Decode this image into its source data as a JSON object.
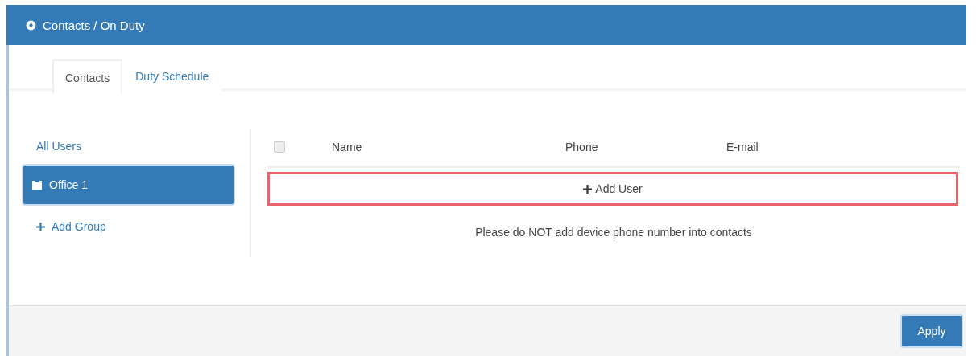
{
  "header": {
    "title": "Contacts / On Duty"
  },
  "tabs": [
    {
      "label": "Contacts",
      "selected": true
    },
    {
      "label": "Duty Schedule",
      "selected": false
    }
  ],
  "groups": [
    {
      "label": "All Users",
      "selected": false,
      "kind": "all"
    },
    {
      "label": "Office 1",
      "selected": true,
      "kind": "group"
    }
  ],
  "add_group": "Add Group",
  "table": {
    "select_all": {
      "checked": false
    },
    "columns": [
      "Name",
      "Phone",
      "E-mail"
    ]
  },
  "add_user": {
    "label": "Add User",
    "highlighted": true
  },
  "notice": "Please do NOT add device phone number into contacts",
  "footer": {
    "apply": "Apply"
  }
}
